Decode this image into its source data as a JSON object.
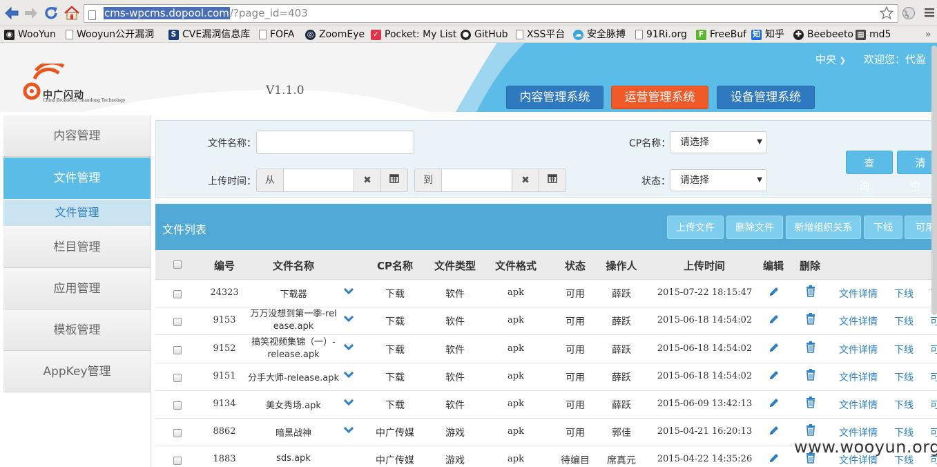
{
  "browser": {
    "url_host": "cms-wpcms.dopool.com",
    "url_rest": "/?page_id=403"
  },
  "bookmarks": [
    {
      "label": "WooYun",
      "icon": "wooyun-icon"
    },
    {
      "label": "Wooyun公开漏洞",
      "icon": "page-icon"
    },
    {
      "label": "CVE漏洞信息库",
      "icon": "cve-icon"
    },
    {
      "label": "FOFA",
      "icon": "page-icon"
    },
    {
      "label": "ZoomEye",
      "icon": "zoomeye-icon"
    },
    {
      "label": "Pocket: My List",
      "icon": "pocket-icon"
    },
    {
      "label": "GitHub",
      "icon": "github-icon"
    },
    {
      "label": "XSS平台",
      "icon": "page-icon"
    },
    {
      "label": "安全脉搏",
      "icon": "cloud-icon"
    },
    {
      "label": "91Ri.org",
      "icon": "page-icon"
    },
    {
      "label": "FreeBuf",
      "icon": "freebuf-icon"
    },
    {
      "label": "知乎",
      "icon": "zhihu-icon"
    },
    {
      "label": "Beebeeto",
      "icon": "beebeeto-icon"
    },
    {
      "label": "md5",
      "icon": "md5-icon"
    }
  ],
  "header": {
    "logo_text": "中广闪动",
    "logo_sub": "China Broadcast Shandong Technology",
    "version": "V1.1.0",
    "region": "中央",
    "welcome": "欢迎您：代盈",
    "systems": [
      {
        "label": "内容管理系统",
        "color": "#2e79c0"
      },
      {
        "label": "运营管理系统",
        "color": "#f05a28"
      },
      {
        "label": "设备管理系统",
        "color": "#2e79c0"
      }
    ]
  },
  "sidebar": {
    "items": [
      "内容管理",
      "文件管理",
      "栏目管理",
      "应用管理",
      "模板管理",
      "AppKey管理"
    ],
    "sub_item": "文件管理"
  },
  "filter": {
    "file_name_label": "文件名称：",
    "upload_time_label": "上传时间：",
    "from": "从",
    "to": "到",
    "cp_label": "CP名称：",
    "status_label": "状态：",
    "select_placeholder": "请选择",
    "query_btn": "查询",
    "clear_btn": "清空"
  },
  "list": {
    "title": "文件列表",
    "actions": [
      "上传文件",
      "删除文件",
      "新增组织关系",
      "下线",
      "可用"
    ],
    "columns": [
      "编号",
      "文件名称",
      "CP名称",
      "文件类型",
      "文件格式",
      "状态",
      "操作人",
      "上传时间",
      "编辑",
      "删除"
    ],
    "detail_link": "文件详情",
    "offline_link": "下线",
    "rows": [
      {
        "id": "24323",
        "name": [
          "下载器"
        ],
        "cp": "下载",
        "type": "软件",
        "format": "apk",
        "status": "可用",
        "operator": "薛跃",
        "time": "2015-07-22 18:15:47",
        "expand": true
      },
      {
        "id": "9153",
        "name": [
          "万万没想到第一季-rel",
          "ease.apk"
        ],
        "cp": "下载",
        "type": "软件",
        "format": "apk",
        "status": "可用",
        "operator": "薛跃",
        "time": "2015-06-18 14:54:02",
        "expand": true
      },
      {
        "id": "9152",
        "name": [
          "搞笑视频集锦（一）-",
          "release.apk"
        ],
        "cp": "下载",
        "type": "软件",
        "format": "apk",
        "status": "可用",
        "operator": "薛跃",
        "time": "2015-06-18 14:54:02",
        "expand": true
      },
      {
        "id": "9151",
        "name": [
          "分手大师-release.apk"
        ],
        "cp": "下载",
        "type": "软件",
        "format": "apk",
        "status": "可用",
        "operator": "薛跃",
        "time": "2015-06-18 14:54:02",
        "expand": true
      },
      {
        "id": "9134",
        "name": [
          "美女秀场.apk"
        ],
        "cp": "下载",
        "type": "软件",
        "format": "apk",
        "status": "可用",
        "operator": "薛跃",
        "time": "2015-06-09 13:42:13",
        "expand": true
      },
      {
        "id": "8862",
        "name": [
          "暗黑战神"
        ],
        "cp": "中广传媒",
        "type": "游戏",
        "format": "apk",
        "status": "可用",
        "operator": "郭佳",
        "time": "2015-04-21 16:20:13",
        "expand": true
      },
      {
        "id": "1883",
        "name": [
          "sds.apk"
        ],
        "cp": "中广传媒",
        "type": "游戏",
        "format": "apk",
        "status": "待编目",
        "operator": "席真元",
        "time": "2015-04-22 14:35:26",
        "expand": false
      }
    ]
  },
  "watermark": "www.wooyun.org",
  "colors": {
    "accent": "#5bbde7",
    "list_bar": "#51a9d6",
    "orange": "#f05a28",
    "blue": "#2e79c0",
    "link": "#2b7fc3"
  }
}
